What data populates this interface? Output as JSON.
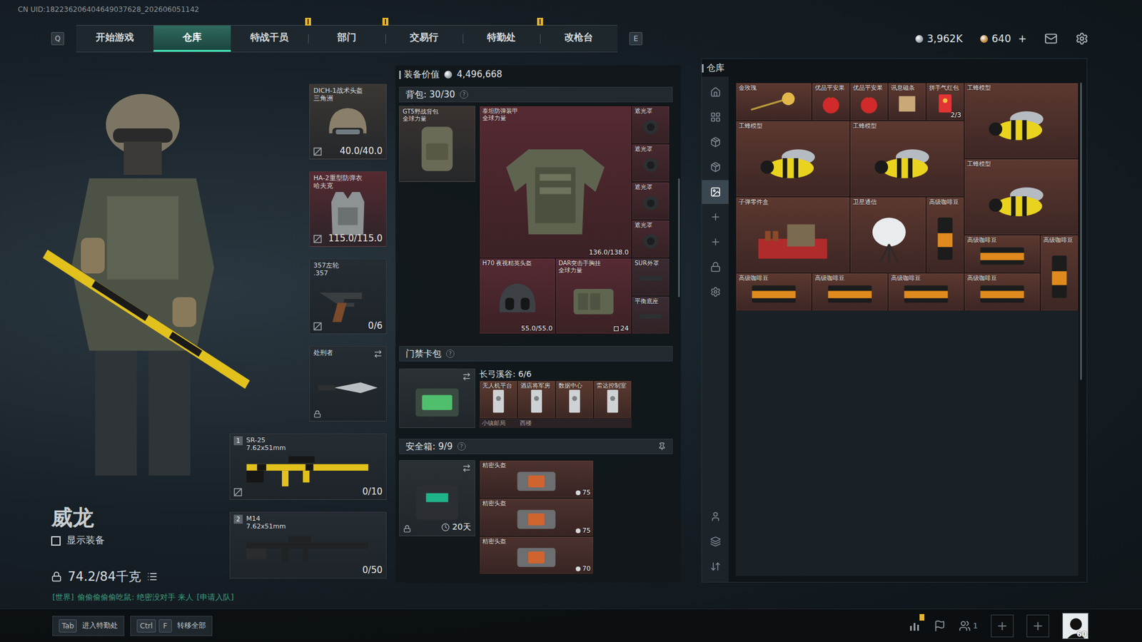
{
  "uid": "CN UID:182236206404649037628_202606051142",
  "nav": {
    "prev_key": "Q",
    "next_key": "E",
    "tabs": [
      {
        "label": "开始游戏",
        "selected": false,
        "notify": false
      },
      {
        "label": "仓库",
        "selected": true,
        "notify": false
      },
      {
        "label": "特战干员",
        "selected": false,
        "notify": true
      },
      {
        "label": "部门",
        "selected": false,
        "notify": true
      },
      {
        "label": "交易行",
        "selected": false,
        "notify": false
      },
      {
        "label": "特勤处",
        "selected": false,
        "notify": true
      },
      {
        "label": "改枪台",
        "selected": false,
        "notify": false
      }
    ]
  },
  "wallet": {
    "coins": "3,962K",
    "tokens": "640",
    "add": "+"
  },
  "character": {
    "name": "威龙",
    "show_gear": {
      "label": "显示装备",
      "checked": false
    },
    "weight": "74.2/84千克"
  },
  "chat": {
    "channel": "[世界]",
    "text": "偷偷偷偷偷吃鼠: 绝密没对手  来人",
    "action": "[申请入队]"
  },
  "equipment": [
    {
      "name": "DICH-1战术头盔",
      "sub": "三角洲",
      "reading": "40.0/40.0",
      "kind": "helmet",
      "color": "#3b3733",
      "marked": true,
      "locked": false,
      "swap": false
    },
    {
      "name": "HA-2重型防弹衣",
      "sub": "哈夫克",
      "reading": "115.0/115.0",
      "kind": "armor",
      "color": "#552a30",
      "marked": true,
      "locked": false,
      "swap": false
    },
    {
      "name": "357左轮",
      "sub": ".357",
      "reading": "0/6",
      "kind": "revolver",
      "color": "#252c32",
      "marked": true,
      "locked": false,
      "swap": false
    },
    {
      "name": "处刑者",
      "kind": "knife",
      "color": "#252c32",
      "marked": false,
      "locked": true,
      "swap": true
    }
  ],
  "weapons": [
    {
      "slot": "1",
      "name": "SR-25",
      "caliber": "7.62x51mm",
      "ammo": "0/10",
      "kind": "camo-rifle",
      "color": "#252c32",
      "marked": true
    },
    {
      "slot": "2",
      "name": "M14",
      "caliber": "7.62x51mm",
      "ammo": "0/50",
      "kind": "rifle",
      "color": "#252c32",
      "marked": false
    }
  ],
  "loadout": {
    "value_label": "装备价值",
    "value": "4,496,668",
    "backpack_bar": {
      "label": "背包: 30/30",
      "help": "?"
    },
    "backpack": {
      "name": "GT5野战背包",
      "sub": "全球力量",
      "kind": "backpack",
      "color": "#3a3330"
    },
    "rig": [
      {
        "name": "泰坦防弹装甲",
        "sub": "全球力量",
        "reading": "136.0/138.0",
        "kind": "heavy-armor",
        "color": "#562a33"
      },
      {
        "name": "遮光罩",
        "kind": "shade",
        "color": "#47292f"
      },
      {
        "name": "遮光罩",
        "kind": "shade",
        "color": "#47292f"
      },
      {
        "name": "遮光罩",
        "kind": "shade",
        "color": "#47292f"
      },
      {
        "name": "遮光罩",
        "kind": "shade",
        "color": "#47292f"
      },
      {
        "name": "H70 夜视精英头盔",
        "reading": "55.0/55.0",
        "kind": "nvg-helmet",
        "color": "#562a33"
      },
      {
        "name": "DAR突击手胸挂",
        "sub": "全球力量",
        "count": "24",
        "kind": "rig",
        "color": "#562a33"
      },
      {
        "name": "SUR外罩",
        "kind": "part",
        "color": "#3a2c33"
      },
      {
        "name": "平衡底座",
        "kind": "part",
        "color": "#3a2c33"
      }
    ]
  },
  "keycards": {
    "label": "门禁卡包",
    "help": "?",
    "map": "长弓溪谷: 6/6",
    "cards": [
      {
        "name": "无人机平台",
        "kind": "card",
        "color": "#5a3a30"
      },
      {
        "name": "酒店将军房",
        "kind": "card",
        "color": "#5a3a30"
      },
      {
        "name": "数据中心",
        "kind": "card",
        "color": "#5a3a30"
      },
      {
        "name": "雷达控制室",
        "kind": "card",
        "color": "#5a3a30"
      }
    ],
    "more": [
      "小镇邮局",
      "西楼"
    ]
  },
  "safebox": {
    "label": "安全箱: 9/9",
    "help": "?",
    "timer": "20天",
    "items": [
      {
        "name": "精密头盔",
        "value": "75",
        "kind": "case",
        "color": "#4d322e"
      },
      {
        "name": "精密头盔",
        "value": "75",
        "kind": "case",
        "color": "#4d322e"
      },
      {
        "name": "精密头盔",
        "value": "70",
        "kind": "case",
        "color": "#4d322e"
      }
    ]
  },
  "warehouse": {
    "title": "仓库",
    "sidebar": [
      {
        "selected": false
      },
      {
        "selected": false
      },
      {
        "selected": false
      },
      {
        "selected": false
      },
      {
        "selected": true
      },
      {
        "selected": false
      },
      {
        "selected": false
      },
      {
        "selected": false
      },
      {
        "selected": false
      },
      {
        "selected": false
      },
      {
        "selected": false
      },
      {
        "selected": false
      }
    ],
    "items": [
      {
        "name": "金玫瑰",
        "kind": "rose",
        "color": "#5c3830"
      },
      {
        "name": "优品平安果",
        "kind": "apple",
        "color": "#5c3830"
      },
      {
        "name": "优品平安果",
        "kind": "apple",
        "color": "#5c3830"
      },
      {
        "name": "讯息磁条",
        "kind": "note",
        "color": "#5c3830"
      },
      {
        "name": "拼手气红包",
        "count": "2/3",
        "kind": "redpacket",
        "color": "#5c3830"
      },
      {
        "name": "工蜂模型",
        "kind": "bee",
        "color": "#5c3830"
      },
      {
        "name": "工蜂模型",
        "kind": "bee",
        "color": "#5c3830"
      },
      {
        "name": "工蜂模型",
        "kind": "bee",
        "color": "#5c3830"
      },
      {
        "name": "工蜂模型",
        "kind": "bee",
        "color": "#5c3830"
      },
      {
        "name": "子弹零件盒",
        "kind": "ammokit",
        "color": "#5c3830"
      },
      {
        "name": "卫星通信",
        "kind": "dish",
        "color": "#5c3830"
      },
      {
        "name": "高级咖啡豆",
        "kind": "coffee-bag",
        "color": "#5c3830"
      },
      {
        "name": "高级咖啡豆",
        "kind": "coffee-box",
        "color": "#5c3830"
      },
      {
        "name": "高级咖啡豆",
        "kind": "coffee-bag",
        "color": "#5c3830"
      },
      {
        "name": "高级咖啡豆",
        "kind": "coffee-box",
        "color": "#5c3830"
      },
      {
        "name": "高级咖啡豆",
        "kind": "coffee-box",
        "color": "#5c3830"
      },
      {
        "name": "高级咖啡豆",
        "kind": "coffee-box",
        "color": "#5c3830"
      },
      {
        "name": "高级咖啡豆",
        "kind": "coffee-box",
        "color": "#5c3830"
      }
    ]
  },
  "bottom": {
    "hints": [
      {
        "keys": [
          "Tab"
        ],
        "label": "进入特勤处"
      },
      {
        "keys": [
          "Ctrl",
          "F"
        ],
        "label": "转移全部"
      }
    ],
    "stats_notify": true,
    "squad": "1",
    "add_slots": [
      "+",
      "+"
    ],
    "level": "60"
  }
}
